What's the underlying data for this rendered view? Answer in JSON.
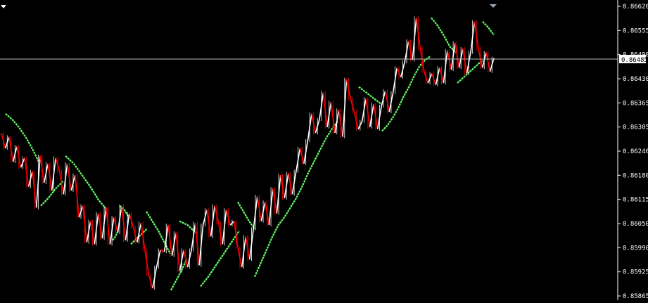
{
  "chart_data": {
    "type": "line",
    "ylim": [
      0.85865,
      0.8662
    ],
    "y_ticks": [
      "0.86620",
      "0.86555",
      "0.86490",
      "0.86430",
      "0.86365",
      "0.86305",
      "0.86240",
      "0.86180",
      "0.86115",
      "0.86050",
      "0.85990",
      "0.85925",
      "0.85865"
    ],
    "current_price_label": "0.86485",
    "current_price": 0.86485,
    "grid": false,
    "colors": {
      "background": "#000000",
      "axis": "#ffffff",
      "bull": "#ffffff",
      "bear": "#ff0000",
      "indicator": "#66ff66",
      "price_line": "#c0c0c0"
    },
    "price_path": [
      0.8629,
      0.8625,
      0.8628,
      0.86215,
      0.86255,
      0.862,
      0.86225,
      0.8615,
      0.8619,
      0.86095,
      0.8623,
      0.8616,
      0.8621,
      0.8614,
      0.86225,
      0.8619,
      0.8613,
      0.8621,
      0.8614,
      0.8618,
      0.8607,
      0.861,
      0.86005,
      0.8606,
      0.86,
      0.8608,
      0.86015,
      0.86095,
      0.86,
      0.8607,
      0.8603,
      0.861,
      0.8601,
      0.8608,
      0.86045,
      0.86005,
      0.86055,
      0.85985,
      0.8592,
      0.85885,
      0.8594,
      0.85985,
      0.8598,
      0.8605,
      0.8597,
      0.8603,
      0.8593,
      0.85985,
      0.8594,
      0.85985,
      0.86055,
      0.85945,
      0.8605,
      0.8609,
      0.8602,
      0.861,
      0.86055,
      0.86,
      0.8609,
      0.8605,
      0.8606,
      0.8599,
      0.8594,
      0.8602,
      0.8596,
      0.8604,
      0.86125,
      0.8606,
      0.8611,
      0.8605,
      0.86145,
      0.8608,
      0.8618,
      0.8612,
      0.86185,
      0.8613,
      0.8619,
      0.8625,
      0.8621,
      0.8627,
      0.8634,
      0.8629,
      0.86325,
      0.86395,
      0.86305,
      0.8637,
      0.8629,
      0.8635,
      0.8628,
      0.8643,
      0.8638,
      0.86345,
      0.863,
      0.8632,
      0.8638,
      0.86305,
      0.86365,
      0.863,
      0.8636,
      0.864,
      0.86345,
      0.86395,
      0.8646,
      0.86435,
      0.86475,
      0.8653,
      0.8648,
      0.8659,
      0.8651,
      0.8645,
      0.8642,
      0.86445,
      0.86415,
      0.8646,
      0.8642,
      0.86505,
      0.86455,
      0.86525,
      0.8646,
      0.8651,
      0.86445,
      0.865,
      0.8658,
      0.8651,
      0.8646,
      0.865,
      0.8645,
      0.86485
    ],
    "indicator_segments": [
      [
        0.8634,
        0.86325,
        0.86305,
        0.8628,
        0.8625,
        0.86215
      ],
      [
        0.861,
        0.8612,
        0.86145,
        0.86165
      ],
      [
        0.8623,
        0.8621,
        0.8618,
        0.8615,
        0.86115,
        0.8609
      ],
      [
        0.8601,
        0.8602,
        0.86035
      ],
      [
        0.861,
        0.8609,
        0.8607
      ],
      [
        0.86,
        0.8602,
        0.8604
      ],
      [
        0.86085,
        0.8606,
        0.86035,
        0.86005,
        0.85975
      ],
      [
        0.8588,
        0.85905,
        0.8593,
        0.8596
      ],
      [
        0.8606,
        0.8605,
        0.8603
      ],
      [
        0.8589,
        0.85915,
        0.85945,
        0.85975,
        0.86005,
        0.86035
      ],
      [
        0.8611,
        0.86085,
        0.8606,
        0.8604
      ],
      [
        0.85915,
        0.8595,
        0.85985,
        0.8602,
        0.8605,
        0.8607,
        0.86095,
        0.8612,
        0.8615,
        0.86185,
        0.86215,
        0.86245,
        0.86275,
        0.863,
        0.8632
      ],
      [
        0.8641,
        0.86395,
        0.8638,
        0.86365
      ],
      [
        0.86295,
        0.8631,
        0.8633,
        0.86355,
        0.86385,
        0.8641,
        0.8644,
        0.86465,
        0.8648,
        0.8649
      ],
      [
        0.8659,
        0.8657,
        0.86545,
        0.86515,
        0.865
      ],
      [
        0.8642,
        0.8644,
        0.8646,
        0.8648
      ],
      [
        0.8658,
        0.86565,
        0.86545
      ]
    ]
  }
}
